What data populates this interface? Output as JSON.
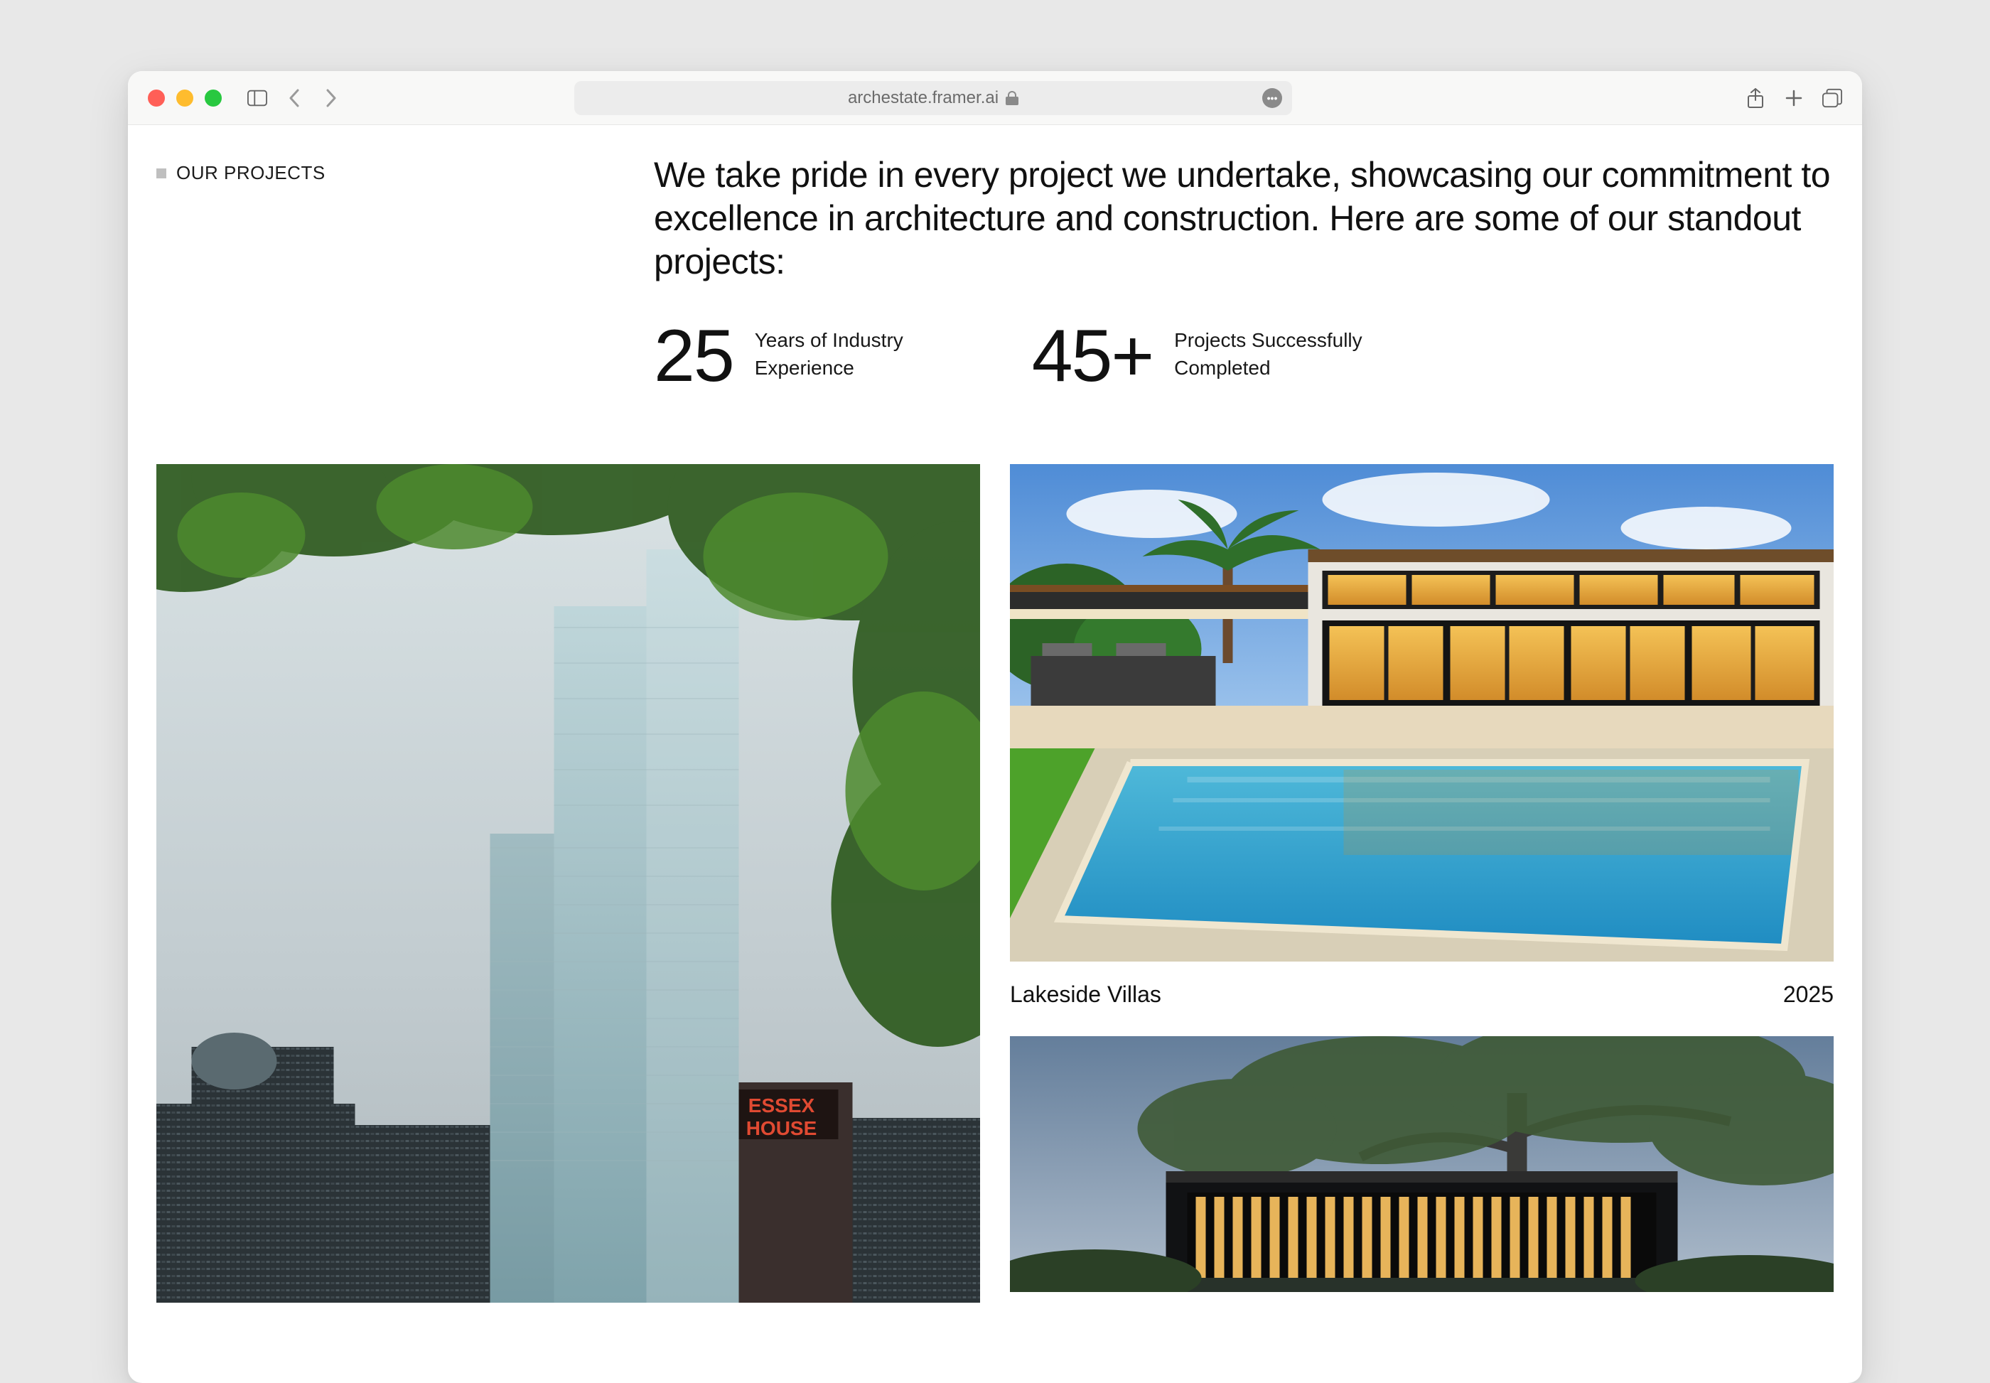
{
  "browser": {
    "url": "archestate.framer.ai"
  },
  "section": {
    "eyebrow": "OUR PROJECTS",
    "headline": "We take pride in every project we undertake, showcasing our commitment to excellence in architecture and construction. Here are some of our standout projects:"
  },
  "stats": [
    {
      "value": "25",
      "label": "Years of Industry Experience"
    },
    {
      "value": "45+",
      "label": "Projects Successfully Completed"
    }
  ],
  "projects": [
    {
      "title": "Lakeside Villas",
      "year": "2025"
    }
  ]
}
